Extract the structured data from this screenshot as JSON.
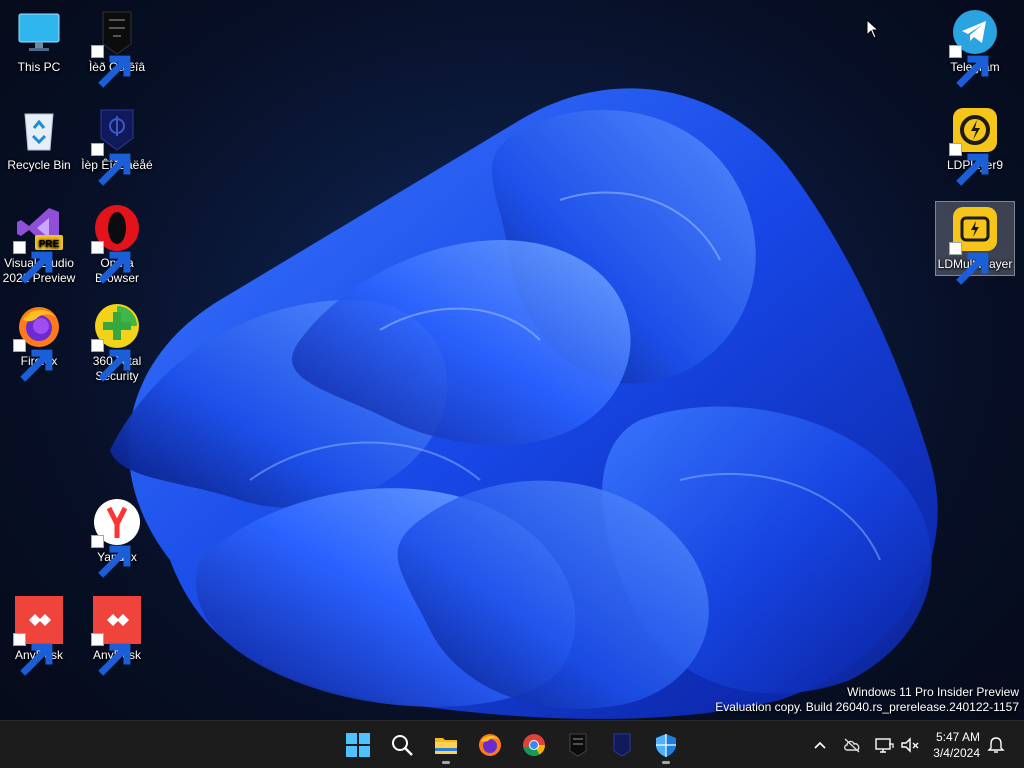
{
  "desktop": {
    "icons": {
      "this_pc": "This PC",
      "unknown1": "Ìèð Òàíêîâ",
      "recycle_bin": "Recycle Bin",
      "unknown2": "Ìèр Êîðàáëåé",
      "vs_line1": "Visual Studio",
      "vs_line2": "2022 Preview",
      "vs_badge": "PRE",
      "opera_line1": "Opera",
      "opera_line2": "Browser",
      "firefox": "Firefox",
      "total360_line1": "360 Total",
      "total360_line2": "Security",
      "yandex": "Yandex",
      "anydesk1": "AnyDesk",
      "anydesk2": "AnyDesk",
      "telegram": "Telegram",
      "ldplayer": "LDPlayer9",
      "ldmulti": "LDMultiPlayer"
    }
  },
  "watermark": {
    "line1": "Windows 11 Pro Insider Preview",
    "line2": "Evaluation copy. Build 26040.rs_prerelease.240122-1157"
  },
  "taskbar": {
    "pinned": [
      "start-icon",
      "search-icon",
      "file-explorer-icon",
      "firefox-icon",
      "chrome-icon",
      "game-icon",
      "warships-icon",
      "defender-icon"
    ],
    "clock": {
      "time": "5:47 AM",
      "date": "3/4/2024"
    }
  },
  "colors": {
    "accent": "#1e5bff",
    "taskbar": "#1c1c1c"
  }
}
